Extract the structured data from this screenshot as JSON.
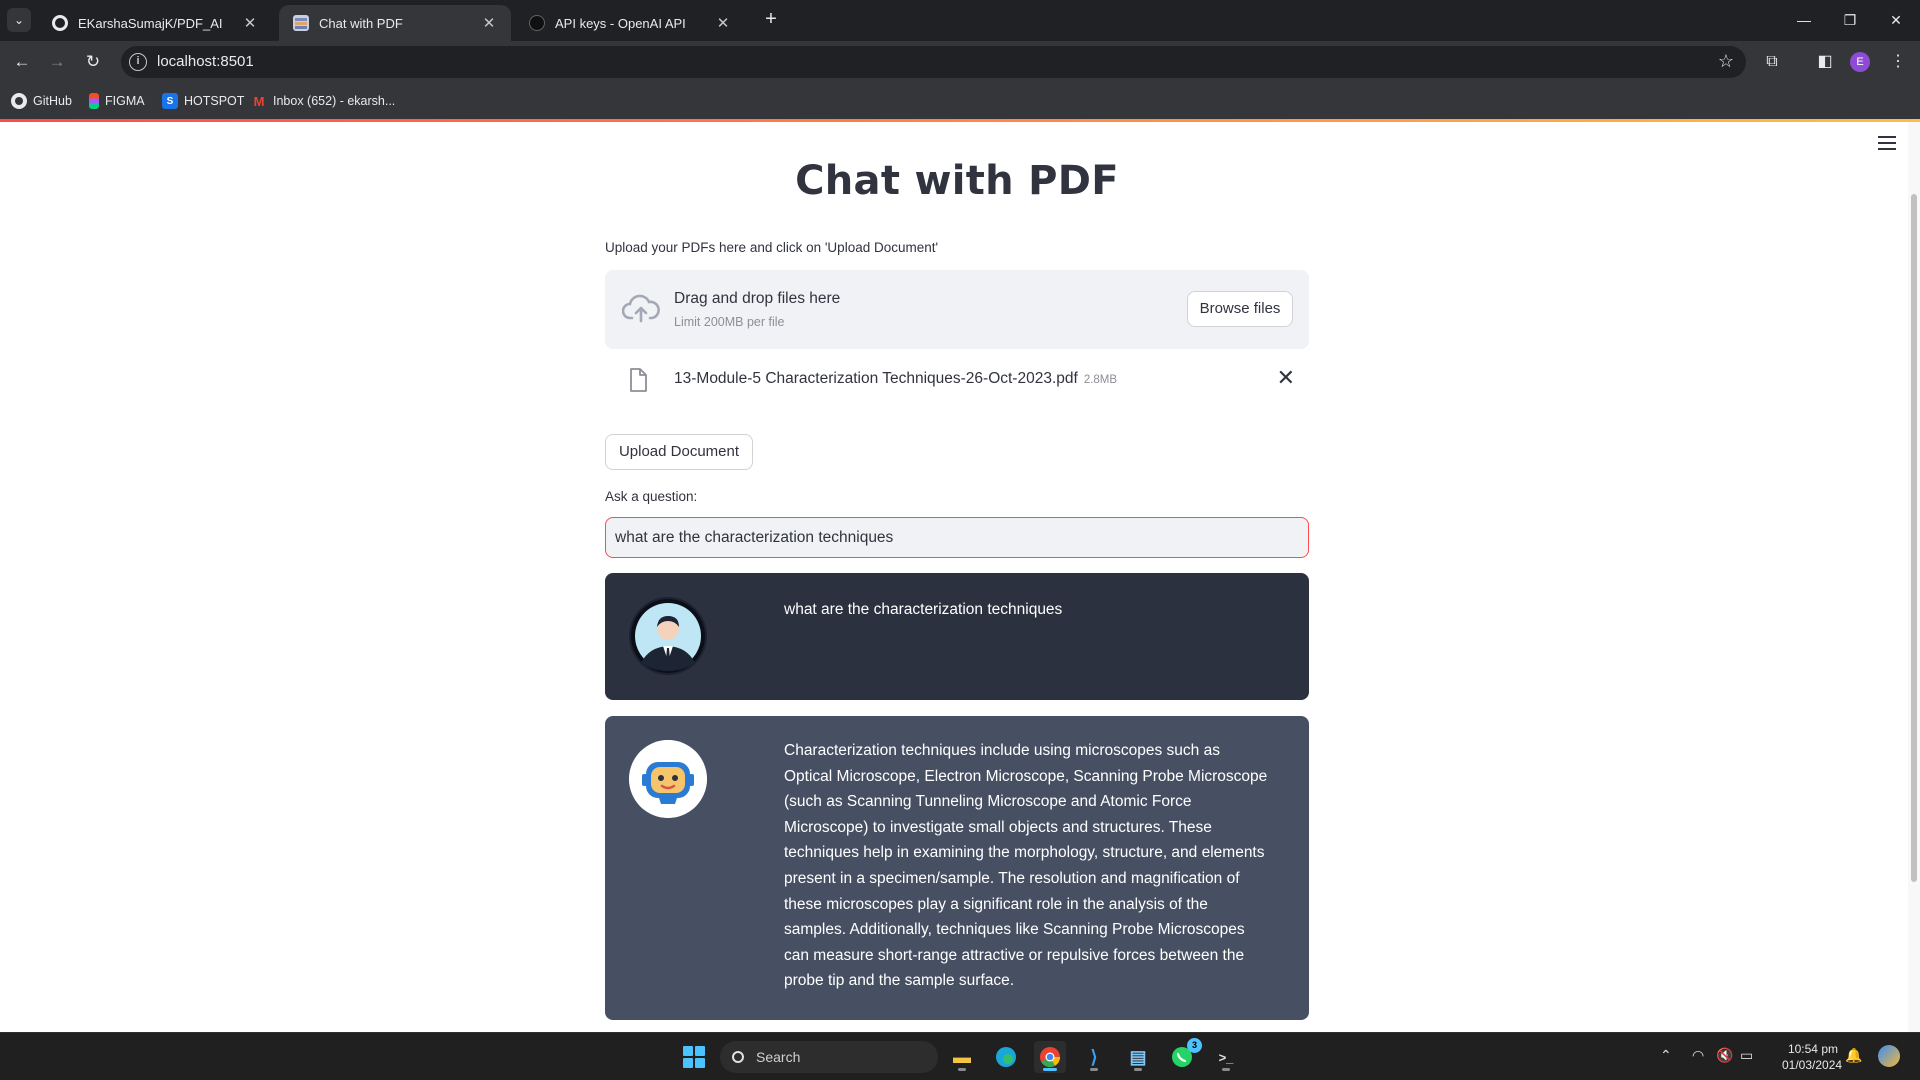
{
  "browser": {
    "tabs": [
      {
        "title": "EKarshaSumajK/PDF_AI",
        "active": false
      },
      {
        "title": "Chat with PDF",
        "active": true
      },
      {
        "title": "API keys - OpenAI API",
        "active": false
      }
    ],
    "url": "localhost:8501",
    "profile_initial": "E",
    "bookmarks": [
      {
        "label": "GitHub",
        "icon": "github-icon"
      },
      {
        "label": "FIGMA",
        "icon": "figma-icon"
      },
      {
        "label": "HOTSPOT",
        "icon": "hotspot-icon"
      },
      {
        "label": "Inbox (652) - ekarsh...",
        "icon": "gmail-icon"
      }
    ]
  },
  "app": {
    "title": "Chat with PDF",
    "upload": {
      "label": "Upload your PDFs here and click on 'Upload Document'",
      "dropzone_title": "Drag and drop files here",
      "limit": "Limit 200MB per file",
      "browse_label": "Browse files",
      "file": {
        "name": "13-Module-5 Characterization Techniques-26-Oct-2023.pdf",
        "size": "2.8MB"
      },
      "upload_button": "Upload Document"
    },
    "question": {
      "label": "Ask a question:",
      "value": "what are the characterization techniques"
    },
    "messages": [
      {
        "role": "user",
        "avatar": "user-avatar-icon",
        "text": "what are the characterization techniques"
      },
      {
        "role": "bot",
        "avatar": "bot-avatar-icon",
        "text": "Characterization techniques include using microscopes such as Optical Microscope, Electron Microscope, Scanning Probe Microscope (such as Scanning Tunneling Microscope and Atomic Force Microscope) to investigate small objects and structures. These techniques help in examining the morphology, structure, and elements present in a specimen/sample. The resolution and magnification of these microscopes play a significant role in the analysis of the samples. Additionally, techniques like Scanning Probe Microscopes can measure short-range attractive or repulsive forces between the probe tip and the sample surface."
      }
    ]
  },
  "taskbar": {
    "search_placeholder": "Search",
    "whatsapp_badge": "3",
    "time": "10:54 pm",
    "date": "01/03/2024"
  },
  "colors": {
    "accent": "#ff4b4b",
    "user_bubble": "#2b313e",
    "bot_bubble": "#475063"
  }
}
